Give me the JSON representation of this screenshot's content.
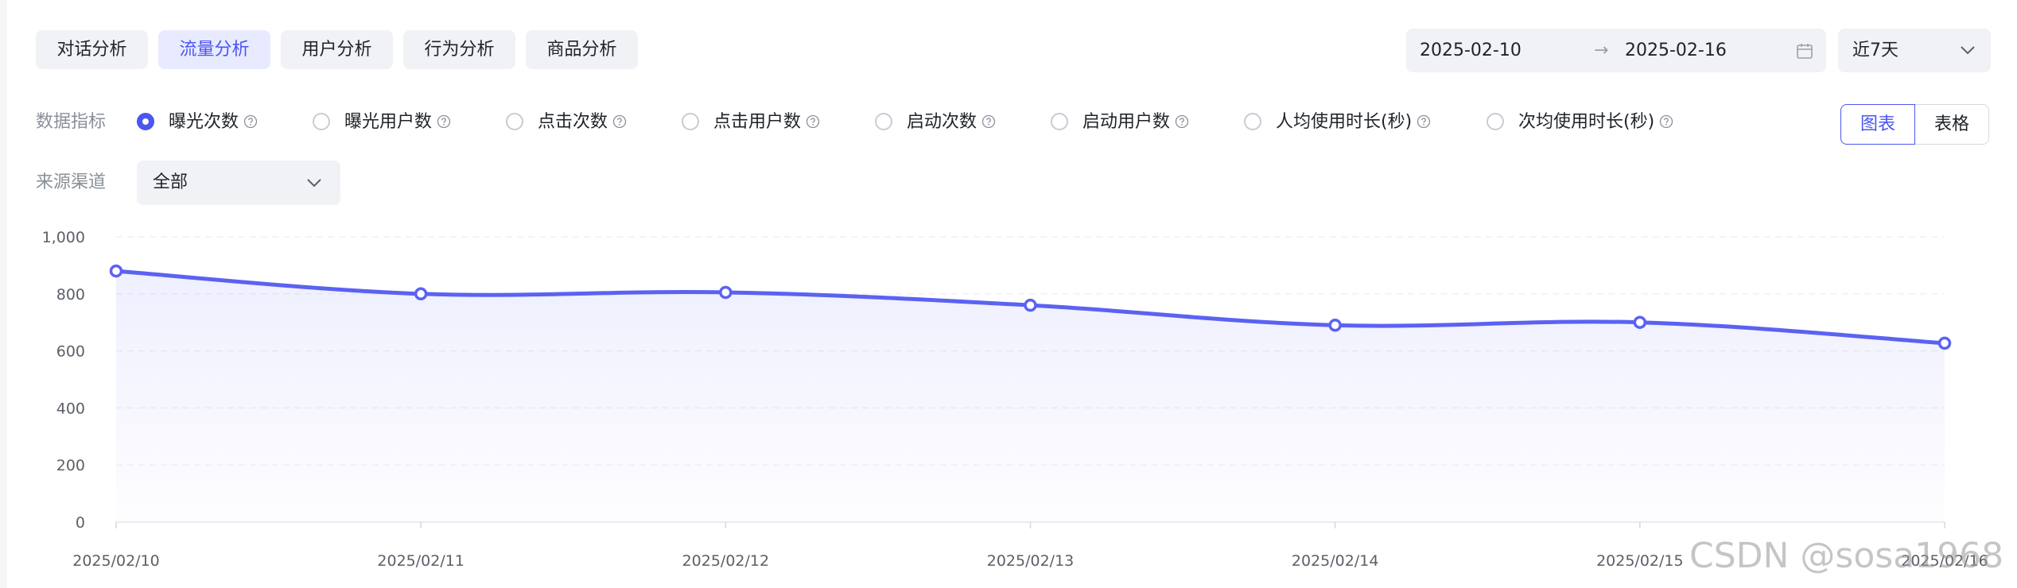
{
  "tabs": [
    {
      "label": "对话分析",
      "active": false
    },
    {
      "label": "流量分析",
      "active": true
    },
    {
      "label": "用户分析",
      "active": false
    },
    {
      "label": "行为分析",
      "active": false
    },
    {
      "label": "商品分析",
      "active": false
    }
  ],
  "date_range": {
    "start": "2025-02-10",
    "arrow": "→",
    "end": "2025-02-16",
    "icon": "calendar-icon"
  },
  "range_select": {
    "value": "近7天",
    "icon": "chevron-down-icon"
  },
  "metrics": {
    "label": "数据指标",
    "options": [
      {
        "label": "曝光次数",
        "checked": true
      },
      {
        "label": "曝光用户数",
        "checked": false
      },
      {
        "label": "点击次数",
        "checked": false
      },
      {
        "label": "点击用户数",
        "checked": false
      },
      {
        "label": "启动次数",
        "checked": false
      },
      {
        "label": "启动用户数",
        "checked": false
      },
      {
        "label": "人均使用时长(秒)",
        "checked": false
      },
      {
        "label": "次均使用时长(秒)",
        "checked": false
      }
    ]
  },
  "view_toggle": {
    "chart_label": "图表",
    "table_label": "表格",
    "selected": "图表"
  },
  "channel": {
    "label": "来源渠道",
    "value": "全部"
  },
  "colors": {
    "accent": "#4b55f0",
    "line": "#5b62f2"
  },
  "chart_data": {
    "type": "line",
    "x": [
      "2025/02/10",
      "2025/02/11",
      "2025/02/12",
      "2025/02/13",
      "2025/02/14",
      "2025/02/15",
      "2025/02/16"
    ],
    "values": [
      880,
      800,
      805,
      760,
      690,
      700,
      627
    ],
    "ylim": [
      0,
      1000
    ],
    "yticks": [
      "0",
      "200",
      "400",
      "600",
      "800",
      "1,000"
    ],
    "grid": true,
    "smooth": true,
    "area_fill": true
  },
  "watermark": "CSDN @sosa1968"
}
